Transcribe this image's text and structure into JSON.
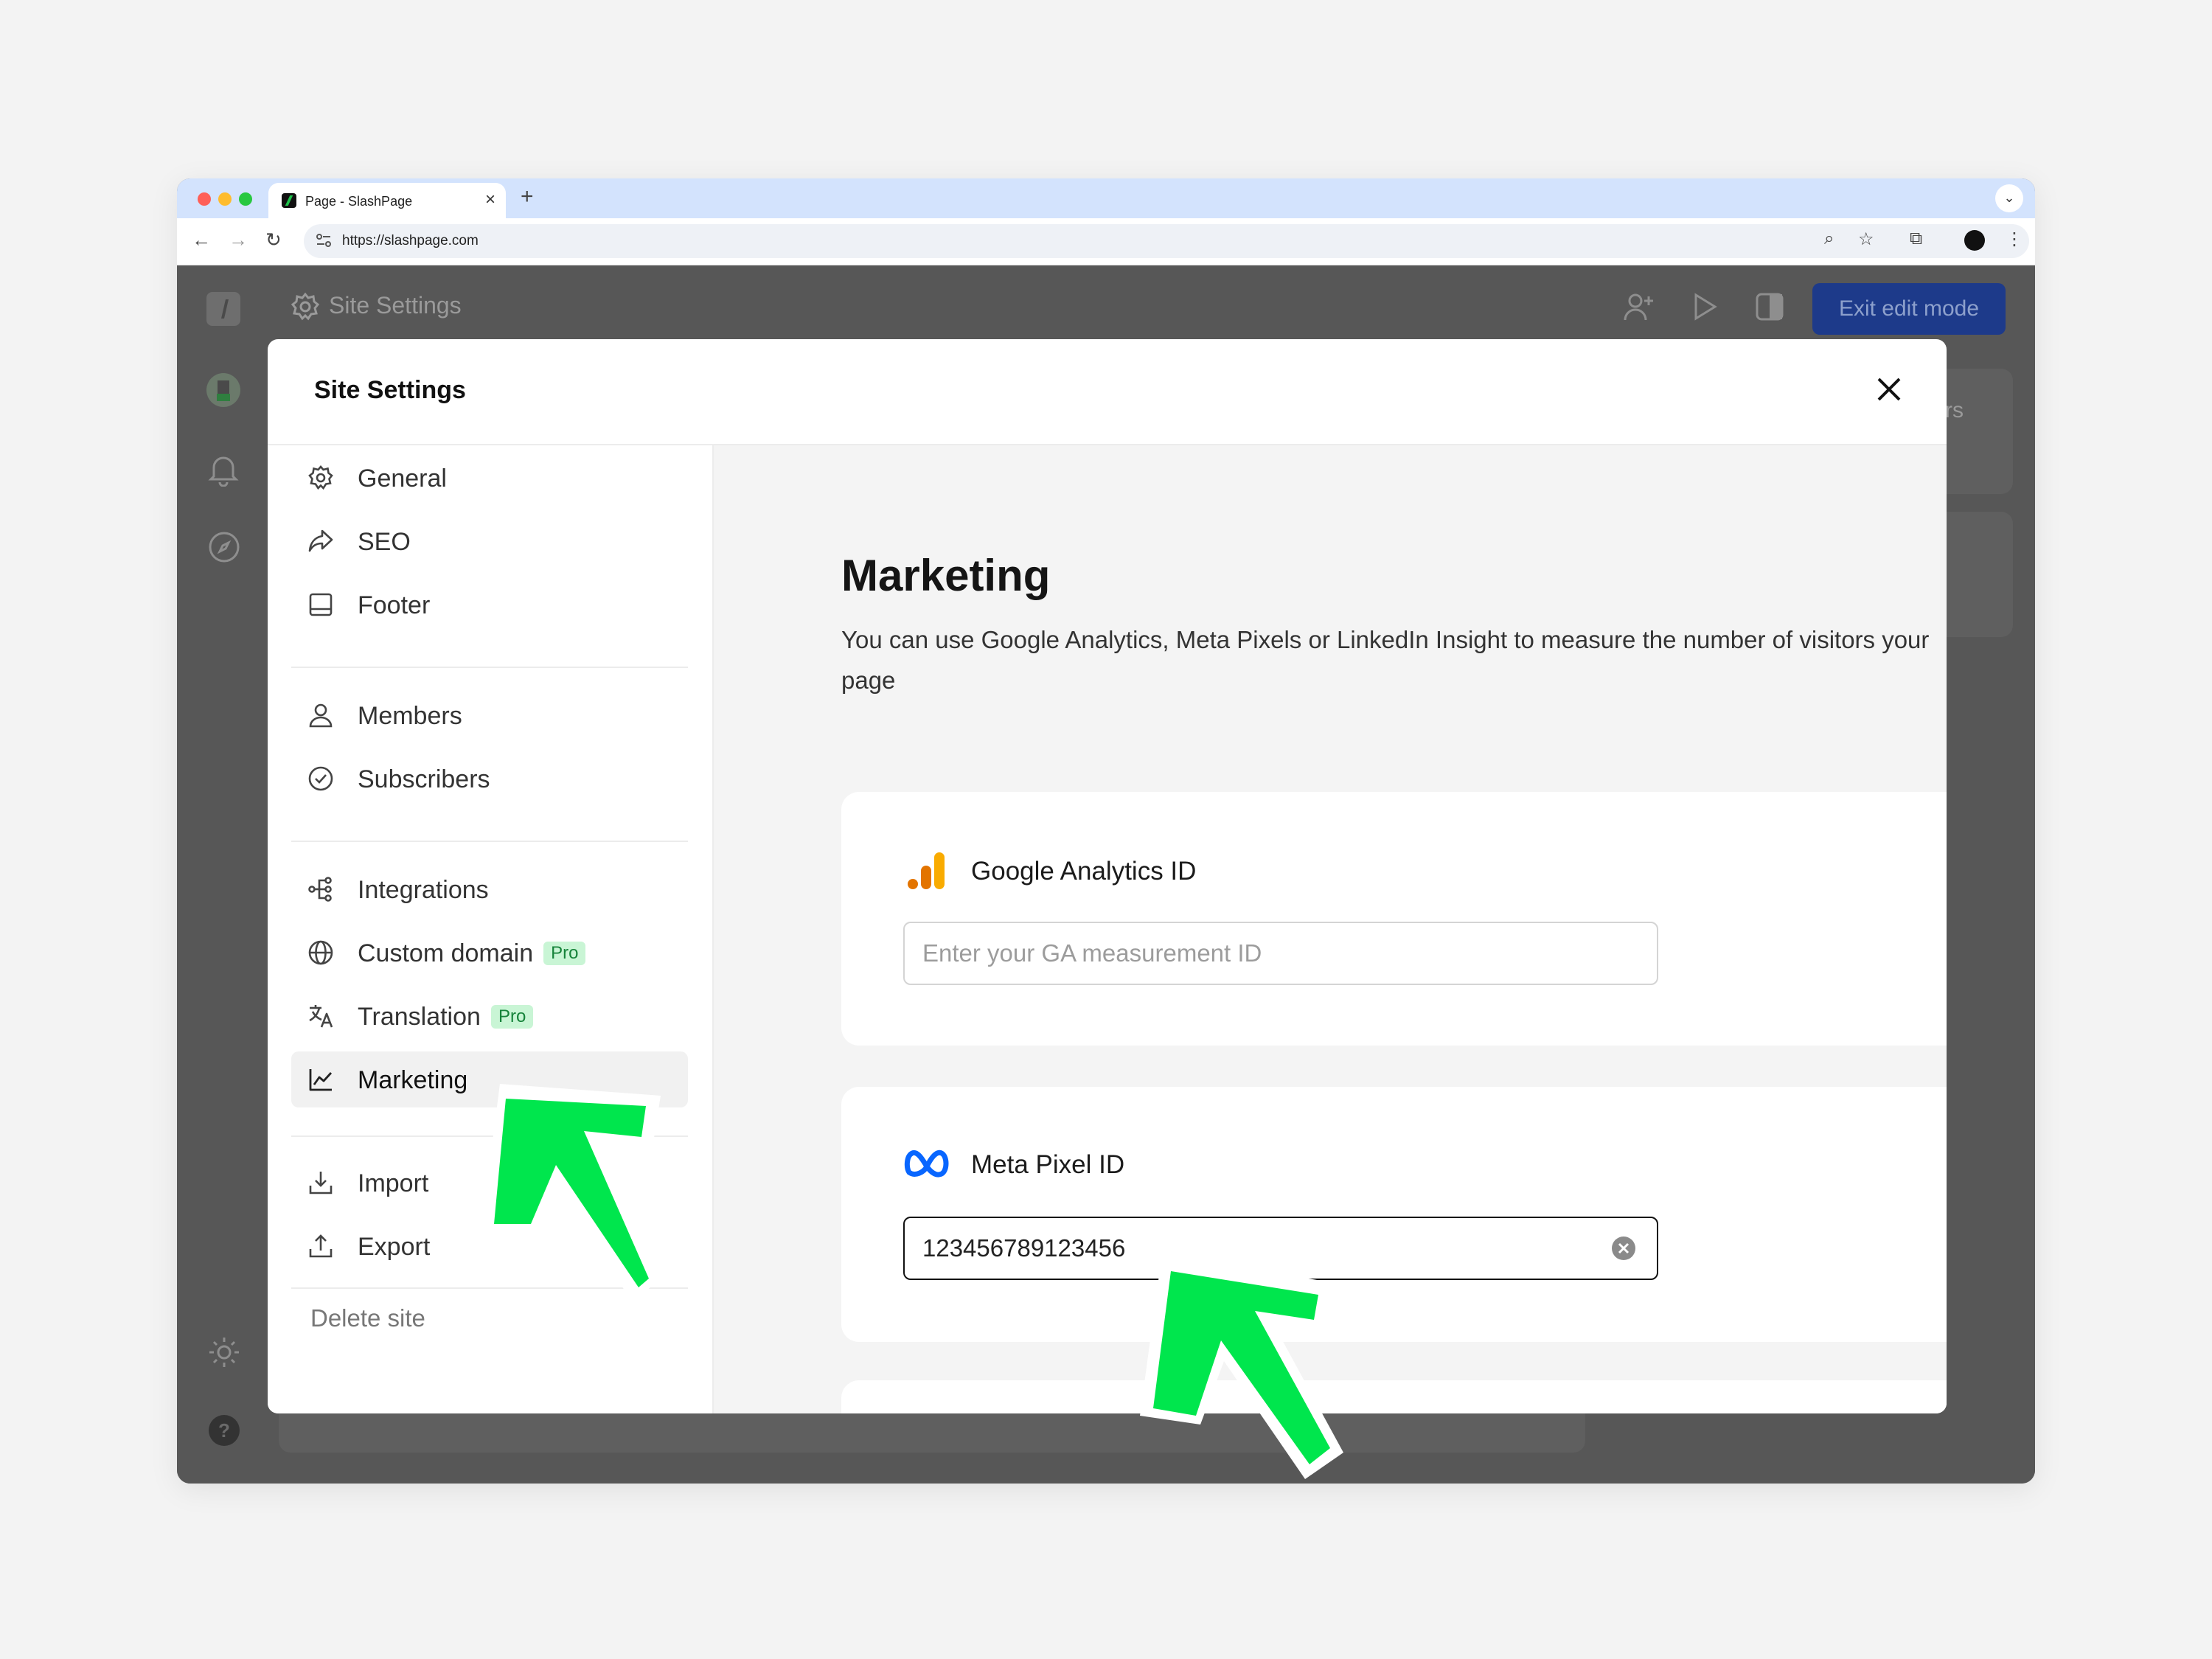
{
  "browser": {
    "tab_title": "Page - SlashPage",
    "url": "https://slashpage.com",
    "new_tab": "+",
    "close_tab": "×"
  },
  "app": {
    "header_title": "Site Settings",
    "exit_button": "Exit edit mode",
    "bg_partial_text": "rs"
  },
  "modal": {
    "title": "Site Settings",
    "nav": {
      "general": "General",
      "seo": "SEO",
      "footer": "Footer",
      "members": "Members",
      "subscribers": "Subscribers",
      "integrations": "Integrations",
      "custom_domain": "Custom domain",
      "translation": "Translation",
      "marketing": "Marketing",
      "import": "Import",
      "export": "Export",
      "pro_badge": "Pro"
    },
    "delete_site": "Delete site"
  },
  "marketing": {
    "heading": "Marketing",
    "description": "You can use Google Analytics, Meta Pixels or LinkedIn Insight to measure the number of visitors your page",
    "ga": {
      "title": "Google Analytics ID",
      "placeholder": "Enter your GA measurement ID",
      "value": ""
    },
    "meta": {
      "title": "Meta Pixel ID",
      "value": "123456789123456"
    }
  },
  "colors": {
    "accent_green": "#00e64d",
    "exit_button": "#1d3a8a",
    "pro_badge_bg": "#c9f5d5"
  }
}
